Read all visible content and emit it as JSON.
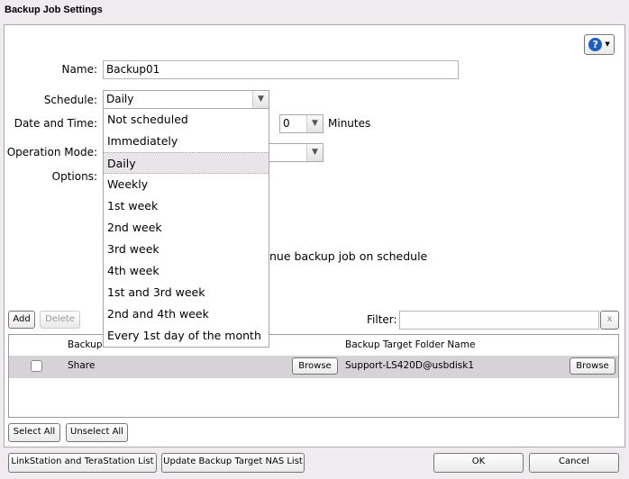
{
  "window": {
    "title": "Backup Job Settings"
  },
  "help": {
    "icon": "help-icon",
    "color": "#1a5fc8"
  },
  "form": {
    "name_label": "Name:",
    "name_value": "Backup01",
    "schedule_label": "Schedule:",
    "schedule_value": "Daily",
    "datetime_label": "Date and Time:",
    "minutes_value": "0",
    "minutes_unit": "Minutes",
    "opmode_label": "Operation Mode:",
    "options_label": "Options:",
    "option_text_partial": "nue backup job on schedule"
  },
  "schedule_options": [
    "Not scheduled",
    "Immediately",
    "Daily",
    "Weekly",
    "1st week",
    "2nd week",
    "3rd week",
    "4th week",
    "1st and 3rd week",
    "2nd and 4th week",
    "Every 1st day of the month"
  ],
  "toolbar": {
    "add": "Add",
    "delete": "Delete",
    "filter_label": "Filter:",
    "filter_value": "",
    "clear": "x"
  },
  "table": {
    "headers": [
      "Backup S",
      "Backup Target Folder Name"
    ],
    "rows": [
      {
        "checked": false,
        "source": "Share",
        "browse": "Browse",
        "target": "Support-LS420D@usbdisk1",
        "browse2": "Browse"
      }
    ]
  },
  "selection": {
    "select_all": "Select All",
    "unselect_all": "Unselect All"
  },
  "footer": {
    "linkstation_list": "LinkStation and TeraStation List",
    "update_list": "Update Backup Target NAS List",
    "ok": "OK",
    "cancel": "Cancel"
  }
}
